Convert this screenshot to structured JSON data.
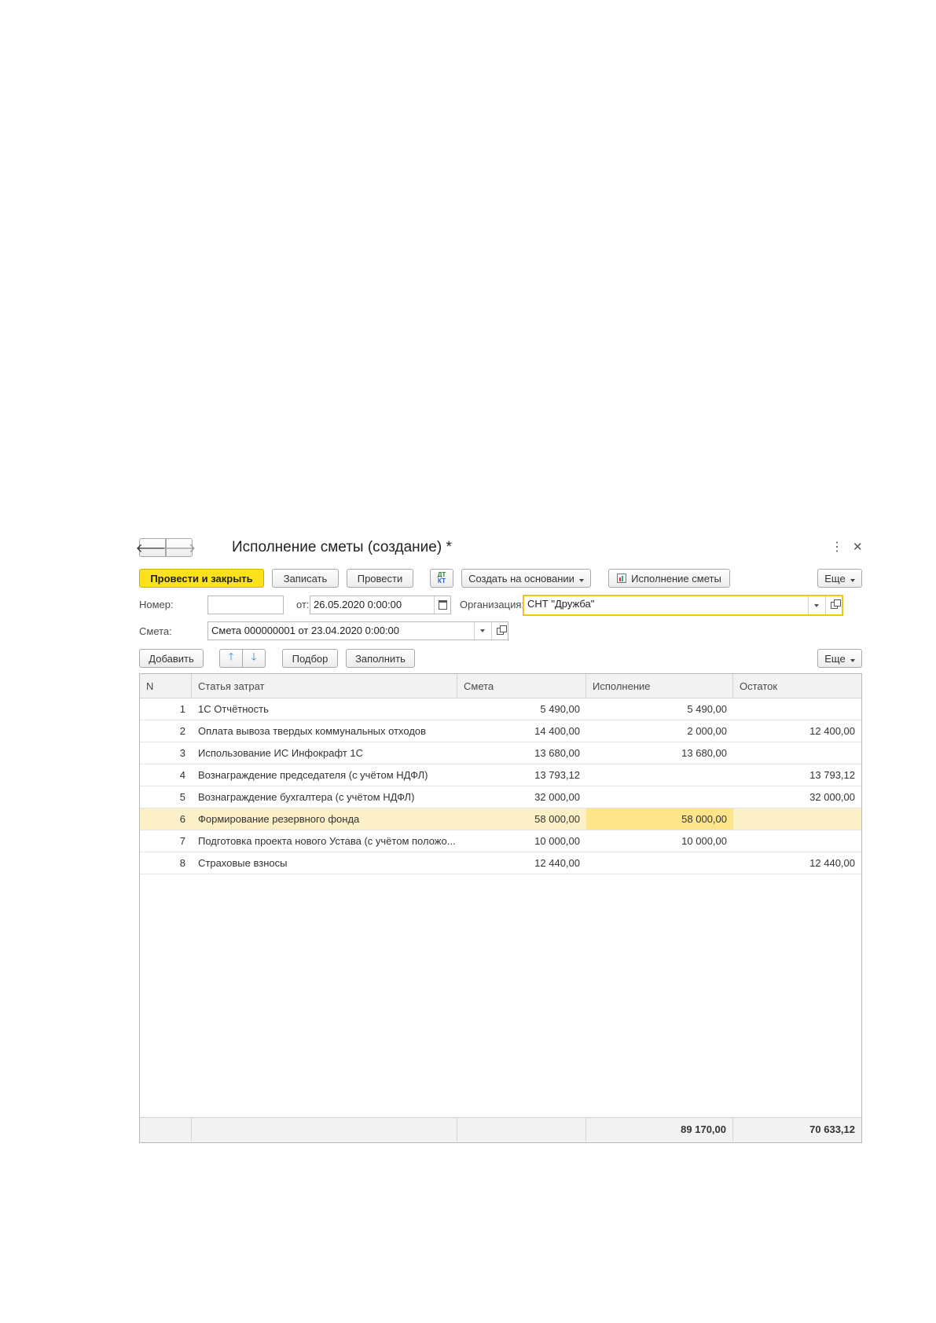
{
  "header": {
    "title": "Исполнение сметы (создание) *",
    "back_icon": "arrow-left-icon",
    "forward_icon": "arrow-right-icon",
    "more_icon": "kebab-menu-icon",
    "close_icon": "close-icon"
  },
  "toolbar": {
    "post_close": "Провести и закрыть",
    "save": "Записать",
    "post": "Провести",
    "dt_kt_icon": "dt-kt-icon",
    "create_based": "Создать на основании",
    "report": "Исполнение сметы",
    "more": "Еще"
  },
  "fields": {
    "number_label": "Номер:",
    "number_value": "",
    "date_label": "от:",
    "date_value": "26.05.2020  0:00:00",
    "org_label": "Организация:",
    "org_value": "СНТ \"Дружба\"",
    "estimate_label": "Смета:",
    "estimate_value": "Смета 000000001 от 23.04.2020 0:00:00"
  },
  "table_toolbar": {
    "add": "Добавить",
    "pick": "Подбор",
    "fill": "Заполнить",
    "more": "Еще",
    "up_icon": "arrow-up-icon",
    "down_icon": "arrow-down-icon"
  },
  "table": {
    "columns": [
      "N",
      "Статья затрат",
      "Смета",
      "Исполнение",
      "Остаток"
    ],
    "rows": [
      {
        "n": "1",
        "item": "1С Отчётность",
        "estimate": "5 490,00",
        "exec": "5 490,00",
        "rest": ""
      },
      {
        "n": "2",
        "item": "Оплата вывоза твердых коммунальных отходов",
        "estimate": "14 400,00",
        "exec": "2 000,00",
        "rest": "12 400,00"
      },
      {
        "n": "3",
        "item": "Использование ИС Инфокрафт 1С",
        "estimate": "13 680,00",
        "exec": "13 680,00",
        "rest": ""
      },
      {
        "n": "4",
        "item": "Вознаграждение председателя (с учётом НДФЛ)",
        "estimate": "13 793,12",
        "exec": "",
        "rest": "13 793,12"
      },
      {
        "n": "5",
        "item": "Вознаграждение бухгалтера (с учётом НДФЛ)",
        "estimate": "32 000,00",
        "exec": "",
        "rest": "32 000,00"
      },
      {
        "n": "6",
        "item": "Формирование резервного фонда",
        "estimate": "58 000,00",
        "exec": "58 000,00",
        "rest": ""
      },
      {
        "n": "7",
        "item": "Подготовка проекта нового Устава (с учётом положо...",
        "estimate": "10 000,00",
        "exec": "10 000,00",
        "rest": ""
      },
      {
        "n": "8",
        "item": "Страховые взносы",
        "estimate": "12 440,00",
        "exec": "",
        "rest": "12 440,00"
      }
    ],
    "totals": {
      "exec": "89 170,00",
      "rest": "70 633,12"
    }
  },
  "colors": {
    "accent": "#fbe21c",
    "selected_row": "#fbf0c8",
    "current_cell": "#fde58c",
    "focus_border": "#f3c317"
  }
}
